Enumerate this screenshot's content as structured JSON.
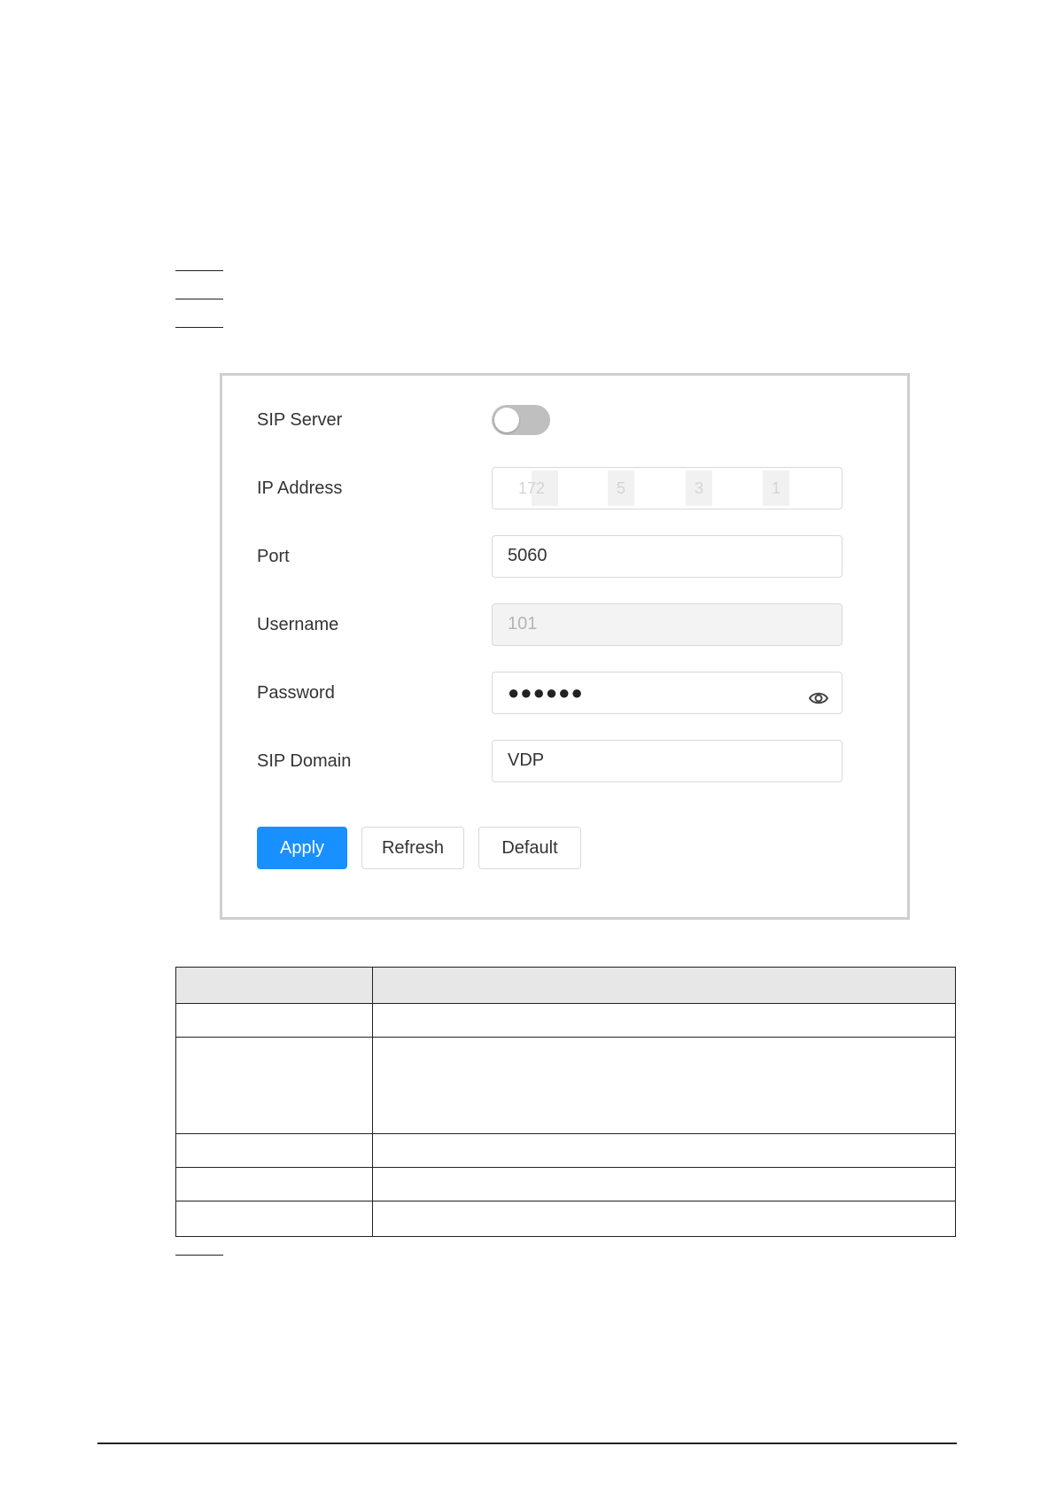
{
  "form": {
    "sip_server": {
      "label": "SIP Server",
      "enabled": false
    },
    "ip_address": {
      "label": "IP Address",
      "segments": [
        "172",
        "5",
        "3",
        "1"
      ]
    },
    "port": {
      "label": "Port",
      "value": "5060"
    },
    "username": {
      "label": "Username",
      "value": "101"
    },
    "password": {
      "label": "Password",
      "masked": "●●●●●●",
      "toggle_icon": "eye-icon"
    },
    "sip_domain": {
      "label": "SIP Domain",
      "value": "VDP"
    }
  },
  "buttons": {
    "apply": "Apply",
    "refresh": "Refresh",
    "default": "Default"
  },
  "colors": {
    "primary": "#1890ff",
    "toggle_off": "#bfbfbf",
    "border": "#d9d9d9",
    "disabled_bg": "#f3f3f3"
  }
}
